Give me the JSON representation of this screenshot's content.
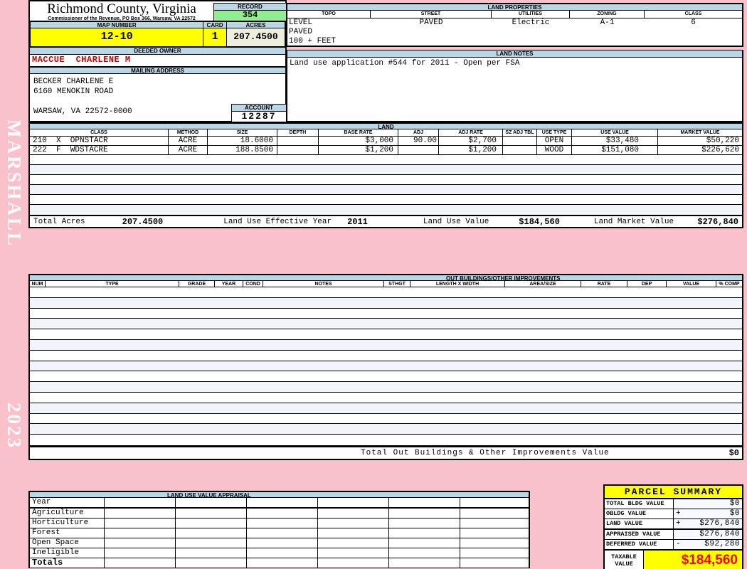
{
  "page": {
    "sidebar_top_label": "MARSHALL",
    "sidebar_bottom_label": "2023"
  },
  "colors": {
    "page_bg": "#F9C1CC",
    "band_blue": "#B9D7E6",
    "record_green": "#90EE90",
    "highlight_yellow": "#FFFF00",
    "acres_beige": "#EEEEDF",
    "owner_red": "#CC0000",
    "taxable_red": "#FF0000"
  },
  "header": {
    "county_title": "Richmond County, Virginia",
    "commissioner_line": "Commissioner of the Revenue, PO Box 366, Warsaw, VA 22572",
    "record_label": "RECORD",
    "record_value": "354",
    "map_number_label": "MAP NUMBER",
    "map_number_value": "12-10",
    "card_label": "CARD",
    "card_value": "1",
    "acres_label": "ACRES",
    "acres_value": "207.4500",
    "deeded_owner_label": "DEEDED OWNER",
    "deeded_owner_value": "MACCUE  CHARLENE M",
    "mailing_address_label": "MAILING ADDRESS",
    "mailing_address_lines": [
      "BECKER CHARLENE E",
      "6160 MENOKIN ROAD",
      "",
      "WARSAW, VA 22572-0000"
    ],
    "account_label": "ACCOUNT",
    "account_value": "12287"
  },
  "land_properties": {
    "title": "LAND PROPERTIES",
    "columns": [
      "TOPO",
      "STREET",
      "UTILITIES",
      "ZONING",
      "CLASS"
    ],
    "topo_lines": [
      "LEVEL",
      "PAVED",
      "100 + FEET"
    ],
    "street": "PAVED",
    "utilities": "Electric",
    "zoning": "A-1",
    "class": "6"
  },
  "land_notes": {
    "title": "LAND NOTES",
    "text": "Land use application #544 for 2011 - Open per FSA"
  },
  "land_table": {
    "title": "LAND",
    "columns": [
      "CLASS",
      "METHOD",
      "SIZE",
      "DEPTH",
      "BASE RATE",
      "ADJ",
      "ADJ RATE",
      "SZ ADJ TBL",
      "USE TYPE",
      "USE VALUE",
      "MARKET VALUE"
    ],
    "rows": [
      {
        "class": "210  X  OPNSTACR",
        "method": "ACRE",
        "size": "18.6000",
        "depth": "",
        "base_rate": "$3,000",
        "adj": "90.00",
        "adj_rate": "$2,700",
        "sz_adj_tbl": "",
        "use_type": "OPEN",
        "use_value": "$33,480",
        "market_value": "$50,220"
      },
      {
        "class": "222  F  WDSTACRE",
        "method": "ACRE",
        "size": "188.8500",
        "depth": "",
        "base_rate": "$1,200",
        "adj": "",
        "adj_rate": "$1,200",
        "sz_adj_tbl": "",
        "use_type": "WOOD",
        "use_value": "$151,080",
        "market_value": "$226,620"
      }
    ],
    "totals": {
      "total_acres_label": "Total Acres",
      "total_acres_value": "207.4500",
      "effective_year_label": "Land Use Effective Year",
      "effective_year_value": "2011",
      "use_value_label": "Land Use Value",
      "use_value_value": "$184,560",
      "market_value_label": "Land Market Value",
      "market_value_value": "$276,840"
    }
  },
  "out_buildings": {
    "title": "OUT BUILDINGS/OTHER IMPROVEMENTS",
    "columns": [
      "NUM",
      "TYPE",
      "GRADE",
      "YEAR",
      "COND",
      "NOTES",
      "STHGT",
      "LENGTH X WIDTH",
      "AREA/SIZE",
      "RATE",
      "DEP",
      "VALUE",
      "% COMP"
    ],
    "total_label": "Total Out Buildings & Other Improvements Value",
    "total_value": "$0"
  },
  "land_use_appraisal": {
    "title": "LAND USE VALUE APPRAISAL",
    "row_labels": [
      "Year",
      "Agriculture",
      "Horticulture",
      "Forest",
      "Open Space",
      "Ineligible",
      "Totals"
    ]
  },
  "parcel_summary": {
    "title": "PARCEL SUMMARY",
    "rows": [
      {
        "label": "TOTAL BLDG VALUE",
        "op": "",
        "value": "$0"
      },
      {
        "label": "OBLDG VALUE",
        "op": "+",
        "value": "$0"
      },
      {
        "label": "LAND VALUE",
        "op": "+",
        "value": "$276,840"
      },
      {
        "label": "APPRAISED VALUE",
        "op": "",
        "value": "$276,840"
      },
      {
        "label": "DEFERRED VALUE",
        "op": "-",
        "value": "$92,280"
      }
    ],
    "taxable_label_line1": "TAXABLE",
    "taxable_label_line2": "VALUE",
    "taxable_value": "$184,560"
  }
}
